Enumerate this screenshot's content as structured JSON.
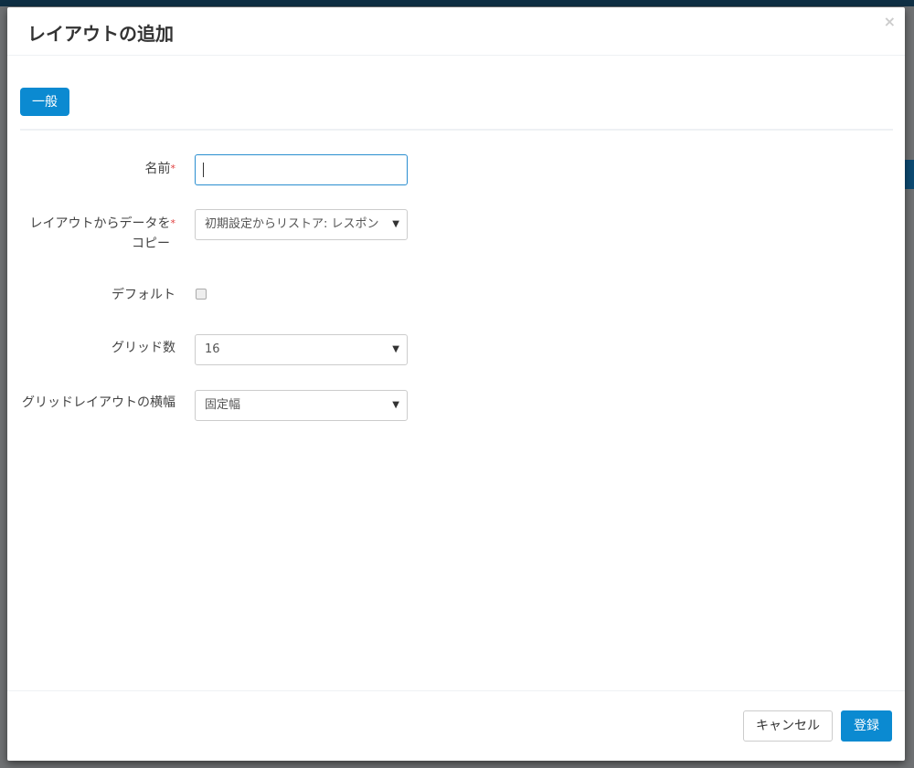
{
  "modal": {
    "title": "レイアウトの追加",
    "close_icon": "×"
  },
  "tabs": [
    {
      "label": "一般"
    }
  ],
  "form": {
    "name": {
      "label": "名前",
      "required": "*",
      "value": ""
    },
    "copy_from": {
      "label_line1": "レイアウトからデータを",
      "label_line2": "コピー",
      "required": "*",
      "value": "初期設定からリストア: レスポンシブ"
    },
    "default": {
      "label": "デフォルト",
      "checked": false
    },
    "grid_count": {
      "label": "グリッド数",
      "value": "16"
    },
    "grid_width": {
      "label": "グリッドレイアウトの横幅",
      "value": "固定幅"
    }
  },
  "footer": {
    "cancel": "キャンセル",
    "submit": "登録"
  },
  "dropdown_arrow": "▼"
}
